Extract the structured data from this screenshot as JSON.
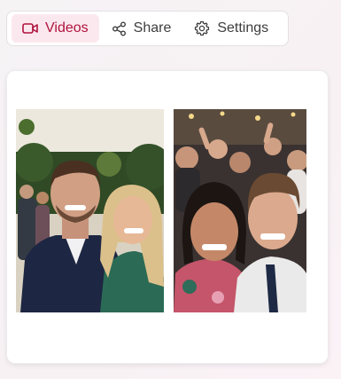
{
  "tabs": [
    {
      "label": "Videos",
      "icon": "video-camera-icon",
      "active": true
    },
    {
      "label": "Share",
      "icon": "share-icon",
      "active": false
    },
    {
      "label": "Settings",
      "icon": "gear-icon",
      "active": false
    }
  ],
  "colors": {
    "accent": "#b0123e",
    "accent_bg": "#fbe8ee",
    "text": "#3d3d3d"
  },
  "gallery": {
    "items": [
      {
        "type": "video-thumbnail",
        "subject": "couple-selfie-garden"
      },
      {
        "type": "video-thumbnail",
        "subject": "couple-selfie-party"
      }
    ]
  }
}
